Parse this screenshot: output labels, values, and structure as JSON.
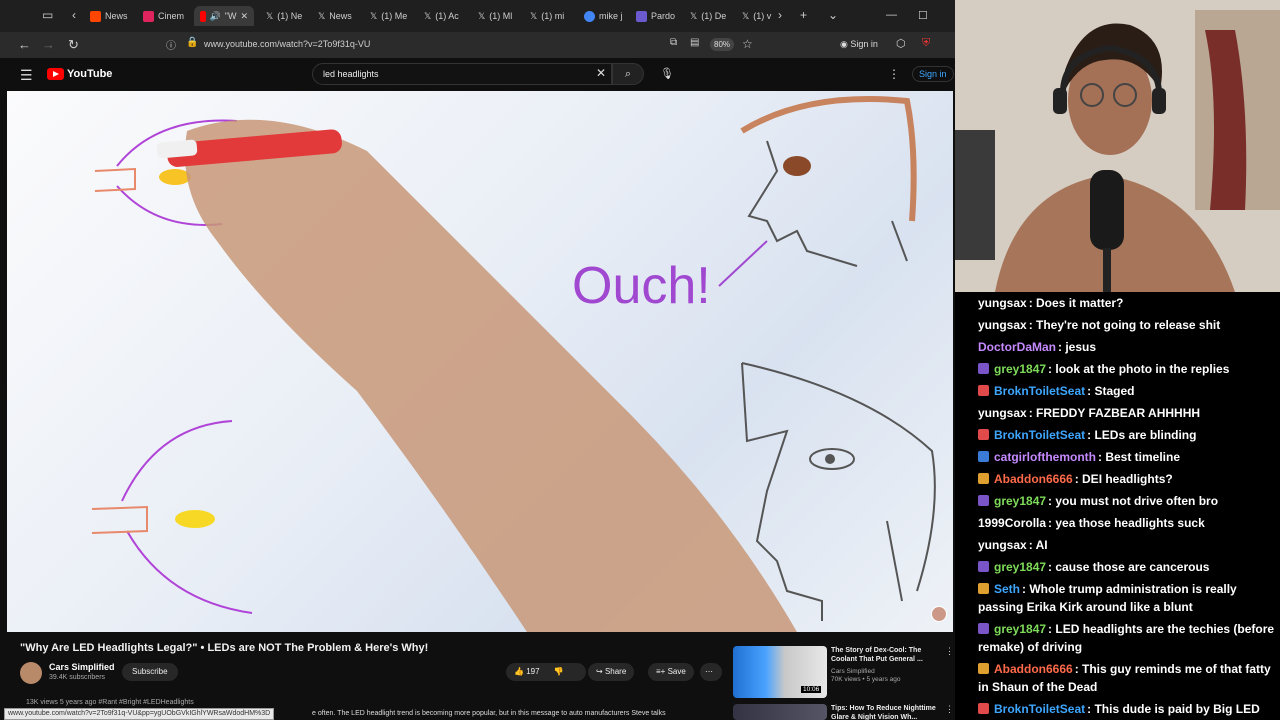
{
  "browser": {
    "tabs": [
      {
        "label": "",
        "icon": "tab-list-icon"
      },
      {
        "label": "News",
        "icon": "reddit-icon"
      },
      {
        "label": "Cinem",
        "icon": "cinema-icon"
      },
      {
        "label": "\"W",
        "icon": "youtube-icon"
      },
      {
        "label": "(1) Ne",
        "icon": "x-icon"
      },
      {
        "label": "News",
        "icon": "x-icon"
      },
      {
        "label": "(1) Me",
        "icon": "x-icon"
      },
      {
        "label": "(1) Ac",
        "icon": "x-icon"
      },
      {
        "label": "(1) Ml",
        "icon": "x-icon"
      },
      {
        "label": "(1) mi",
        "icon": "x-icon"
      },
      {
        "label": "mike j",
        "icon": "google-icon"
      },
      {
        "label": "Pardo",
        "icon": "pardo-icon"
      },
      {
        "label": "(1) De",
        "icon": "x-icon"
      },
      {
        "label": "(1) v",
        "icon": "x-icon"
      }
    ],
    "url": "www.youtube.com/watch?v=2To9f31q-VU",
    "zoom": "80%",
    "signin_label": "Sign in"
  },
  "youtube": {
    "logo_text": "YouTube",
    "search_value": "led headlights",
    "signin_label": "Sign in",
    "video": {
      "overlay_text": "Ouch!",
      "title": "\"Why Are LED Headlights Legal?\" • LEDs are NOT The Problem & Here's Why!",
      "channel": "Cars Simplified",
      "subscribers": "39.4K subscribers",
      "subscribe_label": "Subscribe",
      "likes": "197",
      "share_label": "Share",
      "save_label": "Save",
      "views_line": "13K views  5 years ago  #Rant #Bright #LEDHeadlights",
      "description_snippet": "e often. The LED headlight trend is becoming more popular, but in this message to auto manufacturers Steve talks",
      "status_url": "www.youtube.com/watch?v=2To9f31q-VU&pp=ygUObGVkIGhlYWRsaWdodHM%3D"
    },
    "recommendations": [
      {
        "title": "The Story of Dex-Cool: The Coolant That Put General ...",
        "channel": "Cars Simplified",
        "meta": "70K views • 5 years ago",
        "duration": "10:06"
      },
      {
        "title": "Tips: How To Reduce Nighttime Glare & Night Vision Wh...",
        "channel": "",
        "meta": "",
        "duration": ""
      }
    ]
  },
  "chat": {
    "messages": [
      {
        "user": "yungsax",
        "color": "#ffffff",
        "badge": "",
        "text": ": Does it matter?"
      },
      {
        "user": "yungsax",
        "color": "#ffffff",
        "badge": "",
        "text": ": They're not going to release shit"
      },
      {
        "user": "DoctorDaMan",
        "color": "#c58aff",
        "badge": "",
        "text": ": jesus"
      },
      {
        "user": "grey1847",
        "color": "#7fdc5a",
        "badge": "#7a55c8",
        "text": ": look at the photo in the replies"
      },
      {
        "user": "BroknToiletSeat",
        "color": "#3ea6ff",
        "badge": "#e04a4a",
        "text": ": Staged"
      },
      {
        "user": "yungsax",
        "color": "#ffffff",
        "badge": "",
        "text": ": FREDDY FAZBEAR AHHHHH"
      },
      {
        "user": "BroknToiletSeat",
        "color": "#3ea6ff",
        "badge": "#e04a4a",
        "text": ": LEDs are blinding"
      },
      {
        "user": "catgirlofthemonth",
        "color": "#c58aff",
        "badge": "#3a7bd5",
        "text": ": Best timeline"
      },
      {
        "user": "Abaddon6666",
        "color": "#ff6b4a",
        "badge": "#e0a030",
        "text": ": DEI headlights?"
      },
      {
        "user": "grey1847",
        "color": "#7fdc5a",
        "badge": "#7a55c8",
        "text": ": you must not drive often bro"
      },
      {
        "user": "1999Corolla",
        "color": "#ffffff",
        "badge": "",
        "text": ": yea those headlights suck"
      },
      {
        "user": "yungsax",
        "color": "#ffffff",
        "badge": "",
        "text": ": AI"
      },
      {
        "user": "grey1847",
        "color": "#7fdc5a",
        "badge": "#7a55c8",
        "text": ": cause those are cancerous"
      },
      {
        "user": "Seth",
        "color": "#3ea6ff",
        "badge": "#e0a030",
        "text": ": Whole trump administration is really passing Erika Kirk around like a blunt"
      },
      {
        "user": "grey1847",
        "color": "#7fdc5a",
        "badge": "#7a55c8",
        "text": ": LED headlights are the techies (before remake) of driving"
      },
      {
        "user": "Abaddon6666",
        "color": "#ff6b4a",
        "badge": "#e0a030",
        "text": ": This guy reminds me of that fatty in Shaun of the Dead"
      },
      {
        "user": "BroknToiletSeat",
        "color": "#3ea6ff",
        "badge": "#e04a4a",
        "text": ": This dude is paid by Big LED"
      }
    ]
  }
}
